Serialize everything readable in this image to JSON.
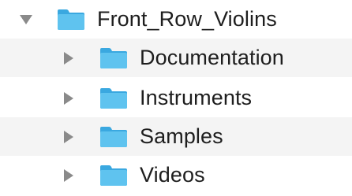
{
  "tree": {
    "root": {
      "label": "Front_Row_Violins",
      "expanded": true,
      "icon": "folder-icon"
    },
    "children": [
      {
        "label": "Documentation",
        "expanded": false,
        "icon": "folder-icon"
      },
      {
        "label": "Instruments",
        "expanded": false,
        "icon": "folder-icon"
      },
      {
        "label": "Samples",
        "expanded": false,
        "icon": "folder-icon"
      },
      {
        "label": "Videos",
        "expanded": false,
        "icon": "folder-icon"
      }
    ]
  },
  "colors": {
    "folder_body": "#5fc3ef",
    "folder_tab": "#3aa8e0",
    "disclosure": "#8a8a8a",
    "alt_row": "#f4f4f4",
    "text": "#1e1e1e"
  }
}
